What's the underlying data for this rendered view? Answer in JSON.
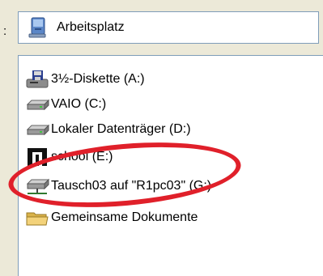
{
  "location_label": ":",
  "address_bar": {
    "value": "Arbeitsplatz",
    "icon": "my-computer-icon"
  },
  "drives": [
    {
      "label": "3½-Diskette (A:)",
      "icon": "floppy-drive-icon"
    },
    {
      "label": "VAIO (C:)",
      "icon": "hard-drive-icon"
    },
    {
      "label": "Lokaler Datenträger (D:)",
      "icon": "hard-drive-icon"
    },
    {
      "label": "school (E:)",
      "icon": "removable-drive-icon"
    },
    {
      "label": "Tausch03 auf \"R1pc03\" (G:)",
      "icon": "network-drive-icon"
    },
    {
      "label": "Gemeinsame Dokumente",
      "icon": "folder-icon"
    }
  ],
  "highlight": {
    "color": "#e0202a",
    "target": "school (E:)"
  }
}
